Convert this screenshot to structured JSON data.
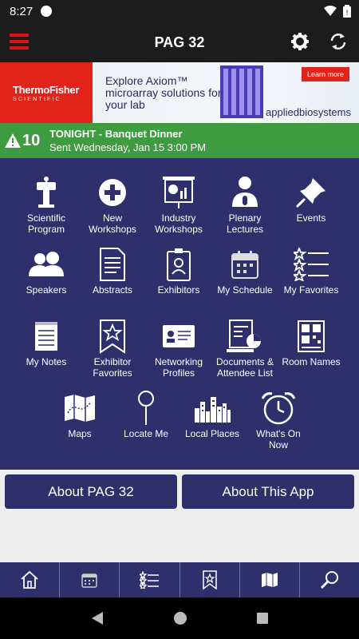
{
  "status": {
    "time": "8:27"
  },
  "appbar": {
    "title": "PAG 32"
  },
  "banner": {
    "brand_line1": "ThermoFisher",
    "brand_line2": "SCIENTIFIC",
    "headline": "Explore Axiom™ microarray solutions for your lab",
    "learn_more": "Learn more",
    "partner": "appliedbiosystems"
  },
  "alert": {
    "count": "10",
    "title": "TONIGHT - Banquet Dinner",
    "subtitle": "Sent Wednesday, Jan 15 3:00 PM"
  },
  "tiles": [
    {
      "label": "Scientific\nProgram",
      "icon": "podium-icon"
    },
    {
      "label": "New\nWorkshops",
      "icon": "plus-circle-icon"
    },
    {
      "label": "Industry\nWorkshops",
      "icon": "presentation-board-icon"
    },
    {
      "label": "Plenary\nLectures",
      "icon": "speaker-mic-icon"
    },
    {
      "label": "Events",
      "icon": "pushpin-icon"
    },
    {
      "label": "Speakers",
      "icon": "people-icon"
    },
    {
      "label": "Abstracts",
      "icon": "document-icon"
    },
    {
      "label": "Exhibitors",
      "icon": "badge-icon"
    },
    {
      "label": "My Schedule",
      "icon": "calendar-icon"
    },
    {
      "label": "My Favorites",
      "icon": "star-list-icon"
    },
    {
      "label": "My Notes",
      "icon": "notepad-icon"
    },
    {
      "label": "Exhibitor\nFavorites",
      "icon": "star-bookmark-icon"
    },
    {
      "label": "Networking\nProfiles",
      "icon": "business-card-icon"
    },
    {
      "label": "Documents &\nAttendee List",
      "icon": "documents-chart-icon"
    },
    {
      "label": "Room Names",
      "icon": "qr-sign-icon"
    },
    {
      "label": "Maps",
      "icon": "map-icon"
    },
    {
      "label": "Locate Me",
      "icon": "map-pin-icon"
    },
    {
      "label": "Local Places",
      "icon": "city-skyline-icon"
    },
    {
      "label": "What's On\nNow",
      "icon": "alarm-clock-icon"
    }
  ],
  "buttons": {
    "about_event": "About PAG 32",
    "about_app": "About This App"
  },
  "tabs": [
    {
      "icon": "home-icon"
    },
    {
      "icon": "calendar-icon"
    },
    {
      "icon": "star-list-icon"
    },
    {
      "icon": "star-bookmark-icon"
    },
    {
      "icon": "map-icon"
    },
    {
      "icon": "search-icon"
    }
  ]
}
